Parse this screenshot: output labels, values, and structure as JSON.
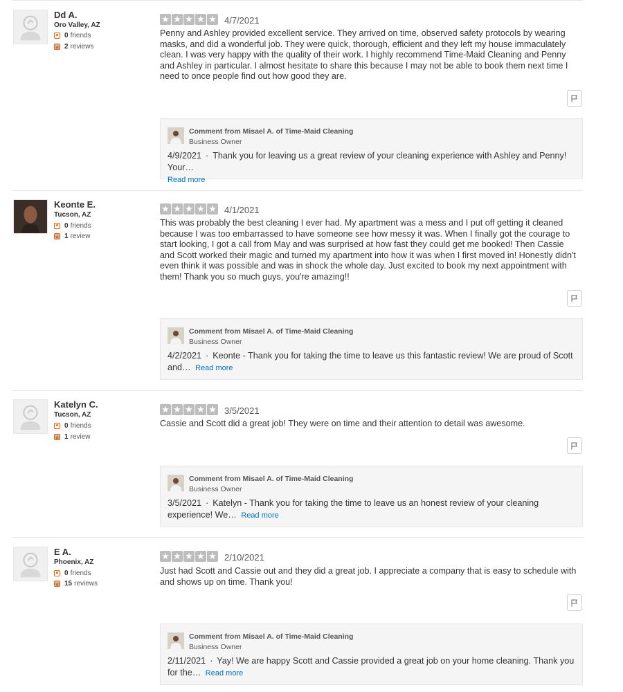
{
  "reviews": [
    {
      "user": {
        "name": "Dd A.",
        "location": "Oro Valley, AZ",
        "friends": "0",
        "friends_label": "friends",
        "reviews": "2",
        "reviews_label": "reviews"
      },
      "rating": 5,
      "date": "4/7/2021",
      "text": "Penny and Ashley provided excellent service.  They arrived on time, observed safety protocols by wearing masks, and did a wonderful job. They were quick, thorough, efficient and they left my house immaculately clean. I was very happy with the quality of their work.  I highly recommend Time-Maid Cleaning and Penny and Ashley in particular. I almost hesitate to share this because I may not be able to book them next time I need to once people find out how good they are.",
      "comment": {
        "from": "Comment from Misael A. of Time-Maid Cleaning",
        "role": "Business Owner",
        "date": "4/9/2021",
        "separator": "·",
        "text": "Thank you for leaving us a great review of your cleaning experience with Ashley and Penny! Your…",
        "read_more": "Read more"
      }
    },
    {
      "user": {
        "name": "Keonte E.",
        "location": "Tucson, AZ",
        "friends": "0",
        "friends_label": "friends",
        "reviews": "1",
        "reviews_label": "review"
      },
      "rating": 5,
      "date": "4/1/2021",
      "text": "This was probably the best cleaning I ever had. My apartment was a mess and I put off getting it cleaned because I was too embarrassed to have someone see how messy it was. When I finally got the courage to start looking, I got a call from May and was surprised at how fast they could get me booked! Then Cassie and Scott worked their magic and turned my apartment into how it was when I first moved in! Honestly didn't even think it was possible and was in shock the whole day. Just excited to book my next appointment with them! Thank you so much guys, you're amazing!!",
      "comment": {
        "from": "Comment from Misael A. of Time-Maid Cleaning",
        "role": "Business Owner",
        "date": "4/2/2021",
        "separator": "·",
        "text": "Keonte - Thank you for taking the time to leave us this fantastic review! We are proud of Scott and…",
        "read_more": "Read more"
      }
    },
    {
      "user": {
        "name": "Katelyn C.",
        "location": "Tucson, AZ",
        "friends": "0",
        "friends_label": "friends",
        "reviews": "1",
        "reviews_label": "review"
      },
      "rating": 5,
      "date": "3/5/2021",
      "text": "Cassie and Scott did a great job! They were on time and their attention to detail was awesome.",
      "comment": {
        "from": "Comment from Misael A. of Time-Maid Cleaning",
        "role": "Business Owner",
        "date": "3/5/2021",
        "separator": "·",
        "text": "Katelyn - Thank you for taking the time to leave us an honest review of your cleaning experience! We…",
        "read_more": "Read more"
      }
    },
    {
      "user": {
        "name": "E A.",
        "location": "Phoenix, AZ",
        "friends": "0",
        "friends_label": "friends",
        "reviews": "15",
        "reviews_label": "reviews"
      },
      "rating": 5,
      "date": "2/10/2021",
      "text": "Just had Scott and Cassie out and they did a great job. I appreciate a company that is easy to schedule with and shows up on time. Thank you!",
      "comment": {
        "from": "Comment from Misael A. of Time-Maid Cleaning",
        "role": "Business Owner",
        "date": "2/11/2021",
        "separator": "·",
        "text": "Yay! We are happy Scott and Cassie provided a great job on your home cleaning. Thank you for the…",
        "read_more": "Read more"
      }
    }
  ],
  "colors": {
    "star_empty": "#bdbdbd",
    "accent": "#f15c00",
    "link": "#0073bb",
    "comment_bg": "#f5f5f5"
  },
  "icons": {
    "flag": "flag-icon",
    "friends": "friends-icon",
    "reviews": "review-star-icon",
    "avatar": "default-avatar-icon"
  }
}
